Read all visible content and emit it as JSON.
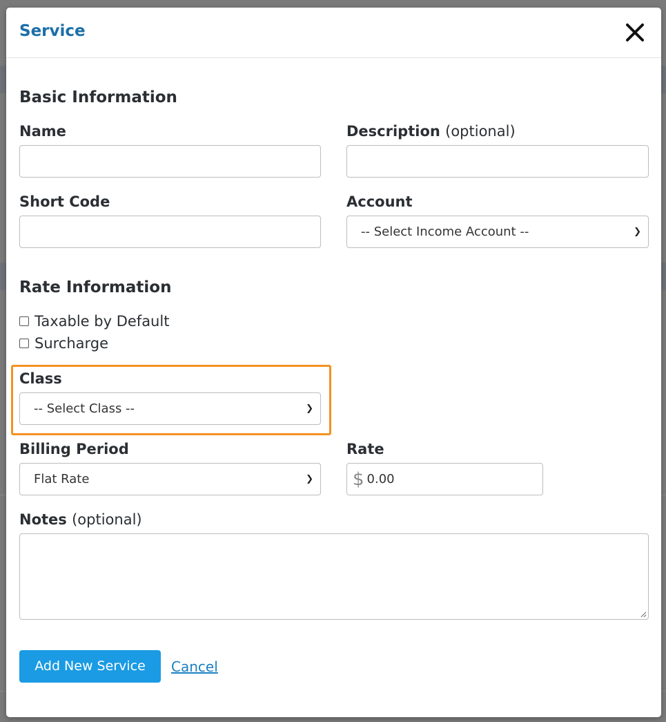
{
  "modal": {
    "title": "Service",
    "close_icon": "close-icon"
  },
  "basic_info": {
    "heading": "Basic Information",
    "name_label": "Name",
    "name_value": "",
    "description_label": "Description",
    "description_optional": "(optional)",
    "description_value": "",
    "short_code_label": "Short Code",
    "short_code_value": "",
    "account_label": "Account",
    "account_selected": "-- Select Income Account --"
  },
  "rate_info": {
    "heading": "Rate Information",
    "taxable_label": "Taxable by Default",
    "taxable_checked": false,
    "surcharge_label": "Surcharge",
    "surcharge_checked": false,
    "class_label": "Class",
    "class_selected": "-- Select Class --",
    "billing_period_label": "Billing Period",
    "billing_period_selected": "Flat Rate",
    "rate_label": "Rate",
    "rate_currency": "$",
    "rate_value": "0.00",
    "notes_label": "Notes",
    "notes_optional": "(optional)",
    "notes_value": ""
  },
  "actions": {
    "add_label": "Add New Service",
    "cancel_label": "Cancel"
  },
  "colors": {
    "title": "#1b6fa8",
    "primary_button": "#1a9be3",
    "highlight": "#f39220",
    "link": "#1a7fc2"
  }
}
